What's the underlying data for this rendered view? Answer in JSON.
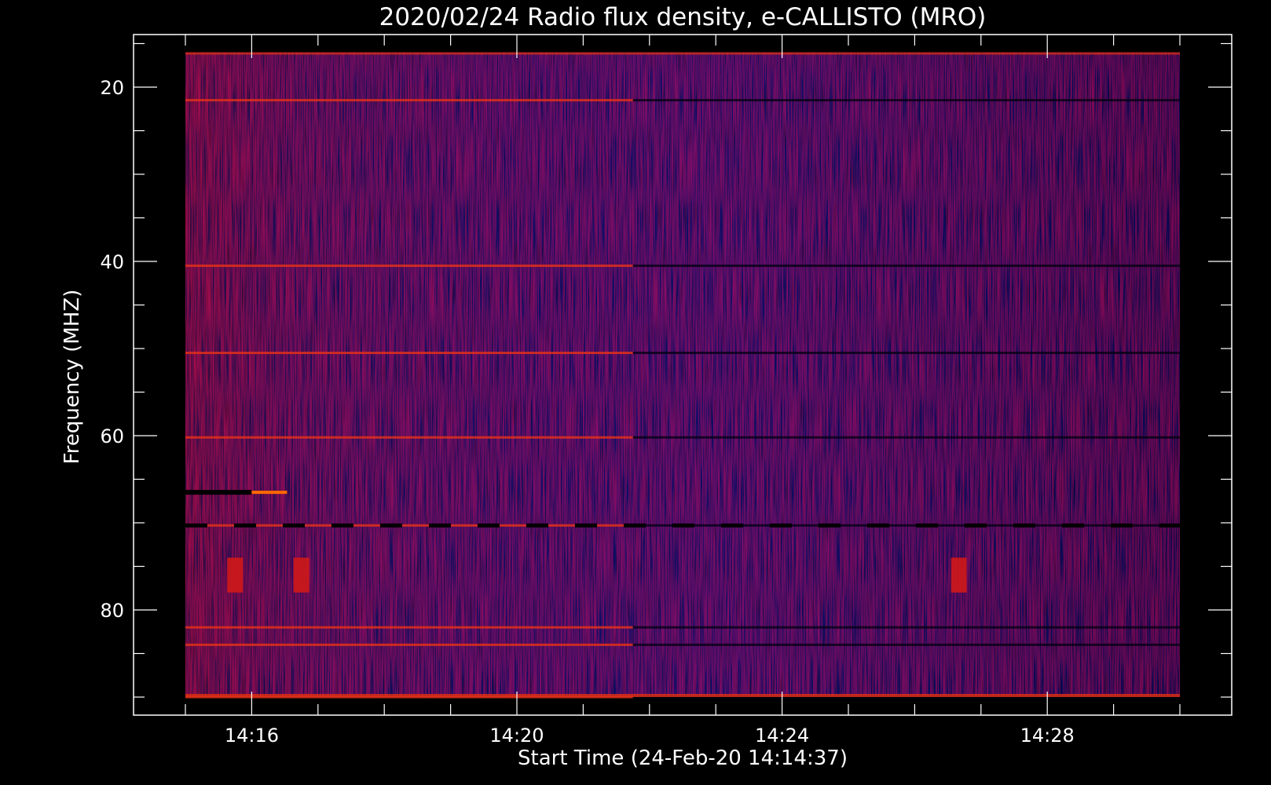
{
  "chart_data": {
    "type": "heatmap",
    "title": "2020/02/24  Radio flux density, e-CALLISTO (MRO)",
    "xlabel": "Start Time (24-Feb-20 14:14:37)",
    "ylabel": "Frequency (MHZ)",
    "x_tick_labels": [
      "14:16",
      "14:20",
      "14:24",
      "14:28"
    ],
    "y_tick_labels": [
      "20",
      "40",
      "60",
      "80"
    ],
    "x_unit": "time (HH:MM)",
    "x_data_range": [
      "14:15:00",
      "14:30:00"
    ],
    "ylim": [
      14,
      92
    ],
    "y_data_range": [
      16,
      90
    ],
    "y_axis_inverted": true,
    "grid": false,
    "legend": "none",
    "colormap": {
      "low": "#000000",
      "mid": "#1f1fe6",
      "high": "#d81b1b",
      "peak": "#ff8a00"
    },
    "background": "#000000",
    "features": {
      "persistent_bright_lines_mhz": [
        21.5,
        40.5,
        50.5,
        60.2,
        70.3,
        82.0,
        84.0,
        90.0
      ],
      "dark_line_mhz": 66.5,
      "dark_line_time_end": "14:16:00",
      "bursts": [
        {
          "time": "14:15:45",
          "freq_range_mhz": [
            74,
            78
          ]
        },
        {
          "time": "14:16:45",
          "freq_range_mhz": [
            74,
            78
          ]
        },
        {
          "time": "14:26:40",
          "freq_range_mhz": [
            74,
            78
          ]
        }
      ]
    }
  }
}
